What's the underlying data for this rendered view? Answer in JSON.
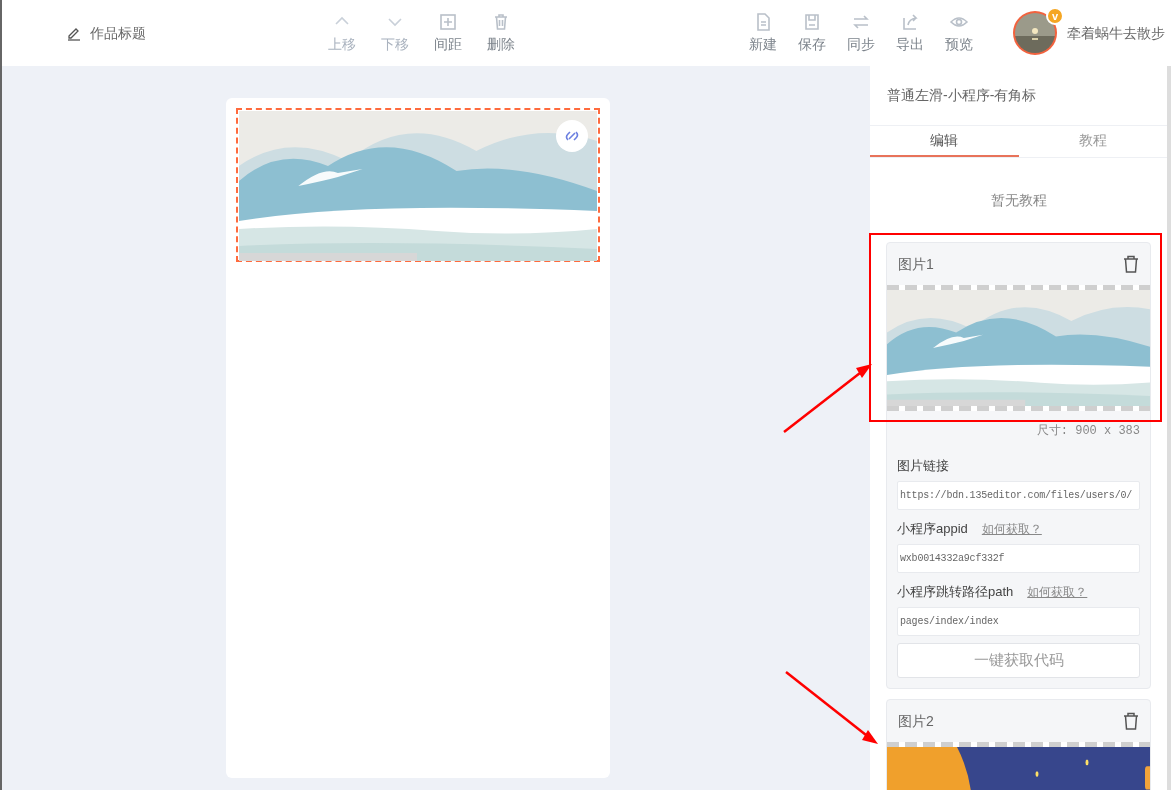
{
  "header": {
    "title": "作品标题",
    "edit_tools": [
      {
        "label": "上移",
        "disabled": true
      },
      {
        "label": "下移",
        "disabled": true
      },
      {
        "label": "间距",
        "disabled": false
      },
      {
        "label": "删除",
        "disabled": false
      }
    ],
    "file_tools": [
      {
        "label": "新建",
        "disabled": false
      },
      {
        "label": "保存",
        "disabled": false
      },
      {
        "label": "同步",
        "disabled": false
      },
      {
        "label": "导出",
        "disabled": false
      },
      {
        "label": "预览",
        "disabled": false
      }
    ],
    "user": {
      "name": "牵着蜗牛去散步",
      "badge": "v"
    }
  },
  "canvas": {
    "banner": {
      "kind": "picture",
      "selected": true
    }
  },
  "panel": {
    "title": "普通左滑-小程序-有角标",
    "tabs": [
      {
        "label": "编辑",
        "selected": true
      },
      {
        "label": "教程",
        "selected": false
      }
    ],
    "empty_text": "暂无教程",
    "images": [
      {
        "title": "图片1",
        "size": "尺寸: 900 x 383",
        "fields": [
          {
            "label": "图片链接",
            "value": "https://bdn.135editor.com/files/users/0/"
          },
          {
            "label": "小程序appid",
            "help": "如何获取？",
            "value": "wxb0014332a9cf332f"
          },
          {
            "label": "小程序跳转路径path",
            "help": "如何获取？",
            "value": "pages/index/index"
          }
        ],
        "button": "一键获取代码"
      },
      {
        "title": "图片2"
      }
    ]
  }
}
